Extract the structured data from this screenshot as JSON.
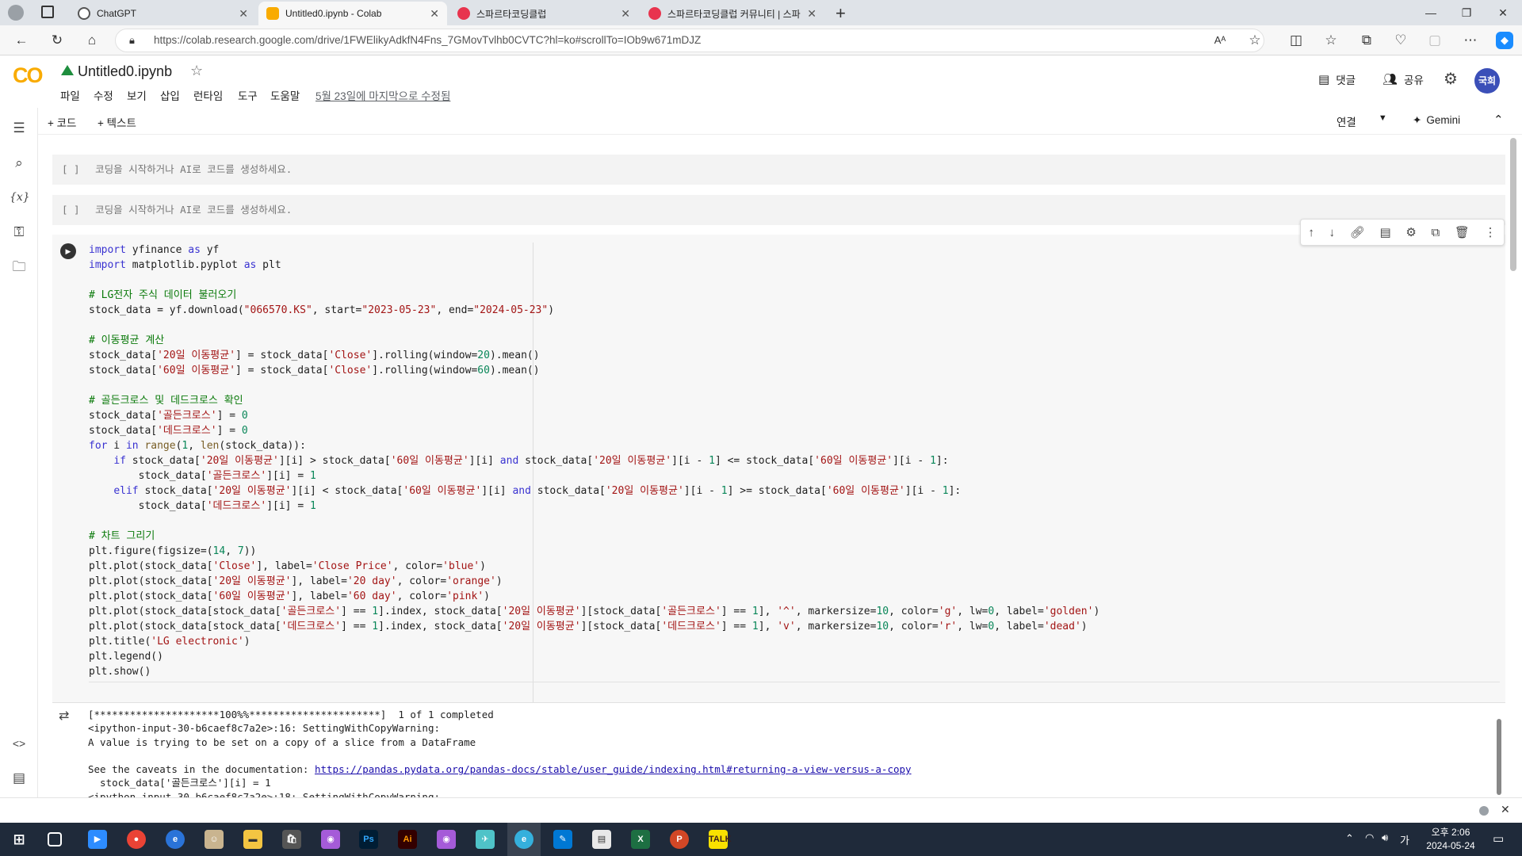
{
  "browser": {
    "tabs": [
      {
        "title": "ChatGPT",
        "active": false
      },
      {
        "title": "Untitled0.ipynb - Colab",
        "active": true
      },
      {
        "title": "스파르타코딩클럽",
        "active": false
      },
      {
        "title": "스파르타코딩클럽 커뮤니티 | 스파",
        "active": false
      }
    ],
    "url": "https://colab.research.google.com/drive/1FWElikyAdkfN4Fns_7GMovTvlhb0CVTC?hl=ko#scrollTo=IOb9w671mDJZ"
  },
  "colab": {
    "logo": "CO",
    "notebook_title": "Untitled0.ipynb",
    "menu": [
      "파일",
      "수정",
      "보기",
      "삽입",
      "런타임",
      "도구",
      "도움말"
    ],
    "last_edited": "5월 23일에 마지막으로 수정됨",
    "comments_label": "댓글",
    "share_label": "공유",
    "avatar": "국희",
    "add_code": "+ 코드",
    "add_text": "+ 텍스트",
    "connect_label": "연결",
    "gemini_label": "Gemini"
  },
  "cells": {
    "empty_prompt_bracket": "[ ]",
    "empty_prompt_text": "코딩을 시작하거나 AI로 코드를 생성하세요."
  },
  "output_lines": [
    "[*********************100%%**********************]  1 of 1 completed",
    "<ipython-input-30-b6caef8c7a2e>:16: SettingWithCopyWarning:",
    "A value is trying to be set on a copy of a slice from a DataFrame",
    "",
    "See the caveats in the documentation: ",
    "  stock_data['골든크로스'][i] = 1",
    "<ipython-input-30-b6caef8c7a2e>:18: SettingWithCopyWarning:"
  ],
  "output_link": "https://pandas.pydata.org/pandas-docs/stable/user_guide/indexing.html#returning-a-view-versus-a-copy",
  "taskbar": {
    "time": "오후 2:06",
    "date": "2024-05-24",
    "ime": "가"
  },
  "colors": {
    "colab_orange": "#f9ab00",
    "avatar_bg": "#3b4fb8",
    "taskbar": "#1f2a3a"
  }
}
